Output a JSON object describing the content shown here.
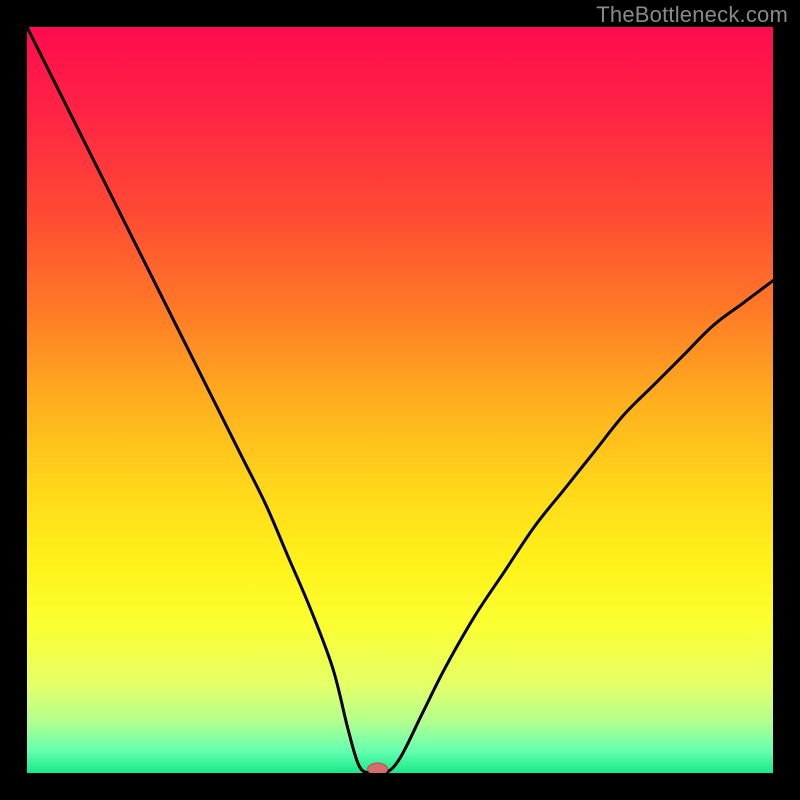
{
  "watermark": "TheBottleneck.com",
  "colors": {
    "background": "#000000",
    "watermark_text": "#8a8a8a",
    "curve": "#000000",
    "marker_fill": "#d86b6b",
    "marker_stroke": "#b54e4e",
    "gradient_stops": [
      {
        "offset": 0.0,
        "color": "#ff0b4e"
      },
      {
        "offset": 0.12,
        "color": "#ff2544"
      },
      {
        "offset": 0.25,
        "color": "#ff4a33"
      },
      {
        "offset": 0.38,
        "color": "#ff7a26"
      },
      {
        "offset": 0.5,
        "color": "#ffae1e"
      },
      {
        "offset": 0.62,
        "color": "#ffd81a"
      },
      {
        "offset": 0.72,
        "color": "#fff21a"
      },
      {
        "offset": 0.8,
        "color": "#fbff30"
      },
      {
        "offset": 0.88,
        "color": "#e6ff66"
      },
      {
        "offset": 0.93,
        "color": "#b4ff8f"
      },
      {
        "offset": 0.97,
        "color": "#66ffb0"
      },
      {
        "offset": 1.0,
        "color": "#17e88a"
      }
    ]
  },
  "chart_data": {
    "type": "line",
    "title": "",
    "xlabel": "",
    "ylabel": "",
    "xlim": [
      0,
      100
    ],
    "ylim": [
      0,
      100
    ],
    "x": [
      0,
      2,
      5,
      8,
      11,
      14,
      17,
      20,
      23,
      26,
      29,
      32,
      35,
      38,
      41,
      43,
      44.5,
      46,
      48,
      50,
      53,
      56,
      60,
      64,
      68,
      72,
      76,
      80,
      84,
      88,
      92,
      96,
      100
    ],
    "values": [
      100,
      96,
      90,
      84,
      78,
      72,
      66,
      60,
      54,
      48,
      42,
      36,
      29,
      22,
      14,
      6,
      1,
      0,
      0,
      2,
      8,
      14,
      21,
      27,
      33,
      38,
      43,
      48,
      52,
      56,
      60,
      63,
      66
    ],
    "marker": {
      "x": 47,
      "y": 0
    },
    "annotations": []
  }
}
